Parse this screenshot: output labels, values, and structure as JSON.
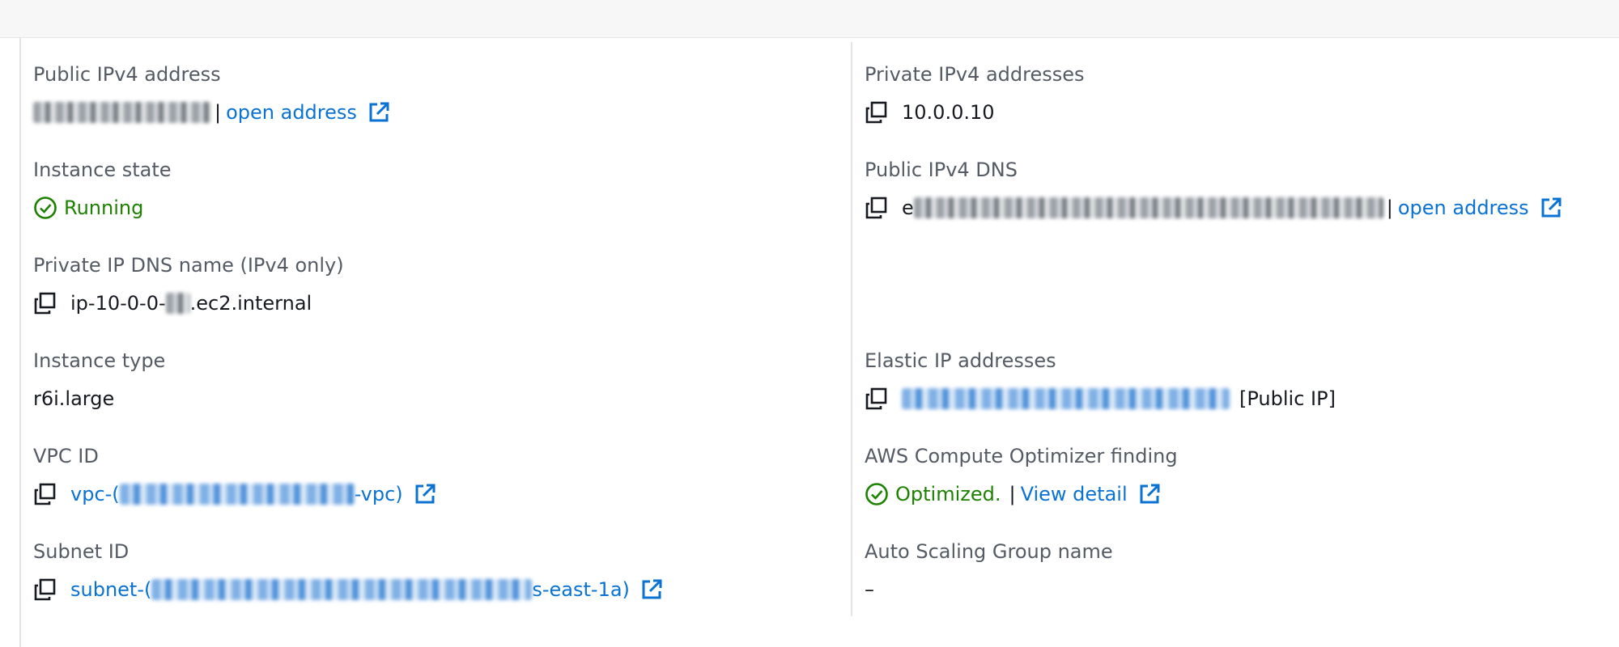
{
  "details": {
    "public_ipv4": {
      "label": "Public IPv4 address",
      "separator": "|",
      "link_text": "open address"
    },
    "instance_state": {
      "label": "Instance state",
      "value": "Running"
    },
    "private_dns": {
      "label": "Private IP DNS name (IPv4 only)",
      "prefix": "ip-10-0-0-",
      "suffix": ".ec2.internal"
    },
    "instance_type": {
      "label": "Instance type",
      "value": "r6i.large"
    },
    "vpc_id": {
      "label": "VPC ID",
      "prefix": "vpc-(",
      "suffix": "-vpc)"
    },
    "subnet_id": {
      "label": "Subnet ID",
      "prefix": "subnet-(",
      "suffix": "s-east-1a)"
    },
    "private_ipv4": {
      "label": "Private IPv4 addresses",
      "value": "10.0.0.10"
    },
    "public_dns": {
      "label": "Public IPv4 DNS",
      "prefix": "e",
      "separator": "|",
      "link_text": "open address"
    },
    "elastic_ip": {
      "label": "Elastic IP addresses",
      "suffix": "[Public IP]"
    },
    "compute_optimizer": {
      "label": "AWS Compute Optimizer finding",
      "value": "Optimized.",
      "separator": "|",
      "link_text": "View detail"
    },
    "auto_scaling": {
      "label": "Auto Scaling Group name",
      "value": "–"
    }
  },
  "colors": {
    "link": "#0972d3",
    "success": "#1d8102",
    "label": "#545b64",
    "text": "#16191f"
  },
  "icons": [
    "copy-icon",
    "external-link-icon",
    "success-check-icon"
  ]
}
